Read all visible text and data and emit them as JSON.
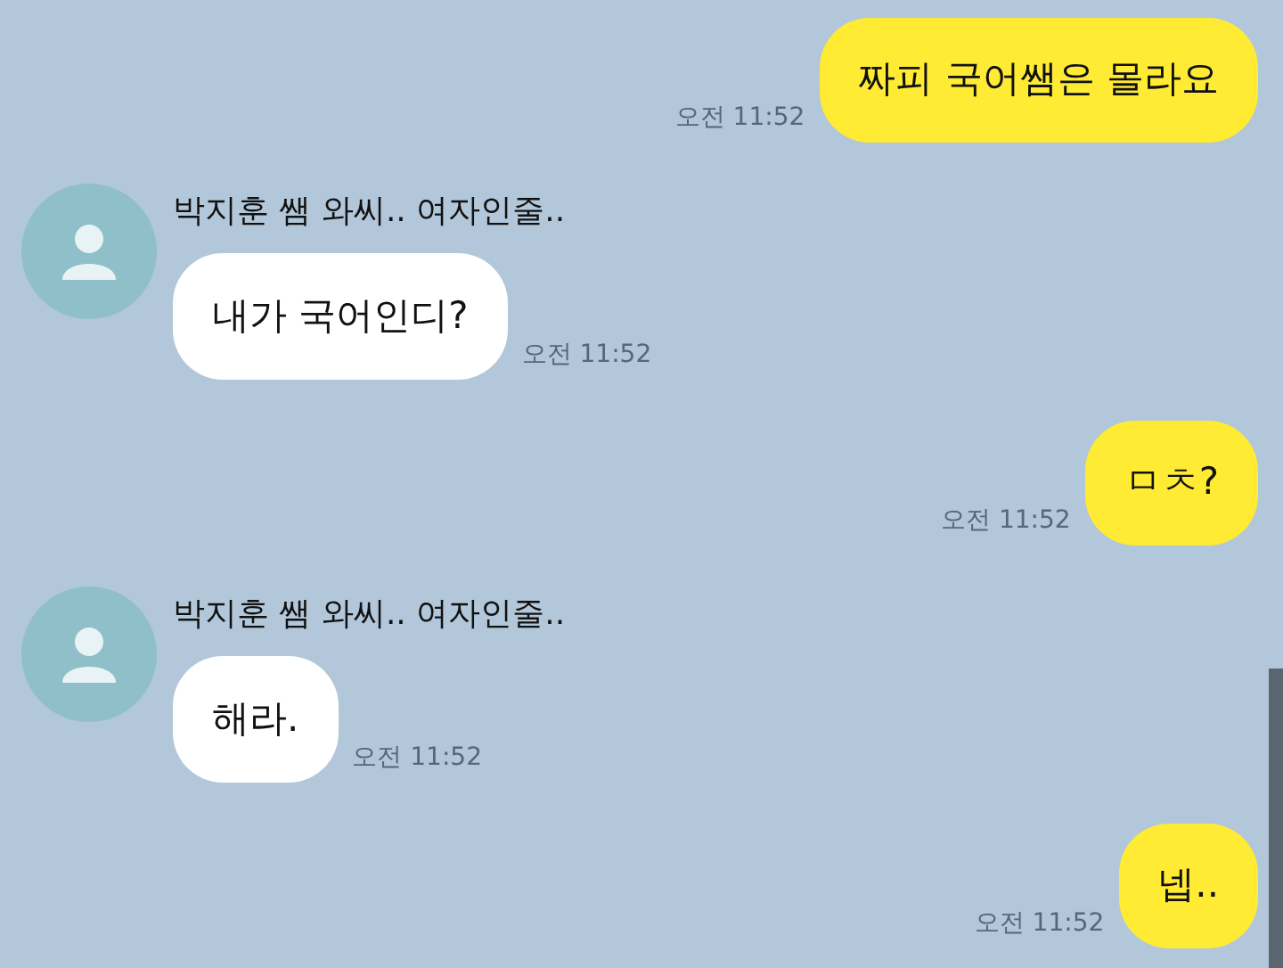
{
  "messages": [
    {
      "kind": "sent",
      "text": "짜피 국어쌤은 몰라요",
      "time": "오전 11:52"
    },
    {
      "kind": "received",
      "sender": "박지훈 쌤 와씨.. 여자인줄..",
      "text": "내가 국어인디?",
      "time": "오전 11:52"
    },
    {
      "kind": "sent",
      "text": "ㅁㅊ?",
      "time": "오전 11:52"
    },
    {
      "kind": "received",
      "sender": "박지훈 쌤 와씨.. 여자인줄..",
      "text": "해라.",
      "time": "오전 11:52"
    },
    {
      "kind": "sent",
      "text": "넵..",
      "time": "오전 11:52"
    }
  ]
}
